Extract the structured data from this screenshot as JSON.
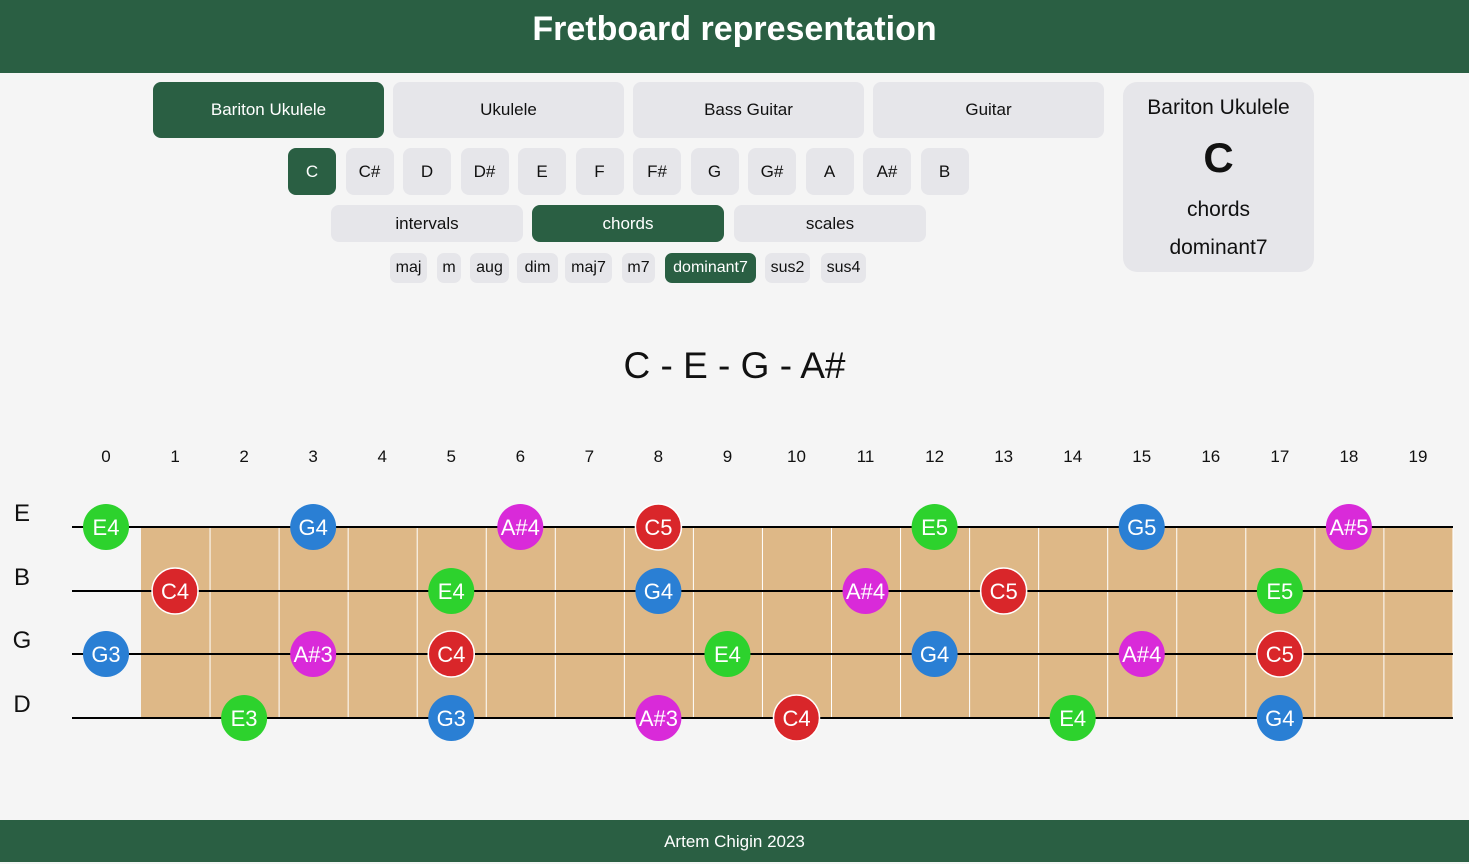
{
  "header": {
    "title": "Fretboard representation"
  },
  "instruments": [
    {
      "label": "Bariton Ukulele",
      "active": true
    },
    {
      "label": "Ukulele",
      "active": false
    },
    {
      "label": "Bass Guitar",
      "active": false
    },
    {
      "label": "Guitar",
      "active": false
    }
  ],
  "keys": [
    {
      "label": "C",
      "active": true
    },
    {
      "label": "C#",
      "active": false
    },
    {
      "label": "D",
      "active": false
    },
    {
      "label": "D#",
      "active": false
    },
    {
      "label": "E",
      "active": false
    },
    {
      "label": "F",
      "active": false
    },
    {
      "label": "F#",
      "active": false
    },
    {
      "label": "G",
      "active": false
    },
    {
      "label": "G#",
      "active": false
    },
    {
      "label": "A",
      "active": false
    },
    {
      "label": "A#",
      "active": false
    },
    {
      "label": "B",
      "active": false
    }
  ],
  "modes": [
    {
      "label": "intervals",
      "active": false
    },
    {
      "label": "chords",
      "active": true
    },
    {
      "label": "scales",
      "active": false
    }
  ],
  "chord_types": [
    {
      "label": "maj",
      "active": false
    },
    {
      "label": "m",
      "active": false
    },
    {
      "label": "aug",
      "active": false
    },
    {
      "label": "dim",
      "active": false
    },
    {
      "label": "maj7",
      "active": false
    },
    {
      "label": "m7",
      "active": false
    },
    {
      "label": "dominant7",
      "active": true
    },
    {
      "label": "sus2",
      "active": false
    },
    {
      "label": "sus4",
      "active": false
    }
  ],
  "info_card": {
    "instrument": "Bariton Ukulele",
    "key": "C",
    "mode": "chords",
    "type": "dominant7"
  },
  "notes_title": "C - E - G - A#",
  "fretboard": {
    "fret_numbers": [
      "0",
      "1",
      "2",
      "3",
      "4",
      "5",
      "6",
      "7",
      "8",
      "9",
      "10",
      "11",
      "12",
      "13",
      "14",
      "15",
      "16",
      "17",
      "18",
      "19"
    ],
    "note_colors": {
      "C": "#d9262a",
      "E": "#2dd22d",
      "G": "#2a7fd4",
      "A#": "#d92ad9"
    },
    "board_color": "#deb887",
    "strings": [
      {
        "name": "E",
        "markers": [
          {
            "fret": 0,
            "note": "E4"
          },
          {
            "fret": 3,
            "note": "G4"
          },
          {
            "fret": 6,
            "note": "A#4"
          },
          {
            "fret": 8,
            "note": "C5"
          },
          {
            "fret": 12,
            "note": "E5"
          },
          {
            "fret": 15,
            "note": "G5"
          },
          {
            "fret": 18,
            "note": "A#5"
          }
        ]
      },
      {
        "name": "B",
        "markers": [
          {
            "fret": 1,
            "note": "C4"
          },
          {
            "fret": 5,
            "note": "E4"
          },
          {
            "fret": 8,
            "note": "G4"
          },
          {
            "fret": 11,
            "note": "A#4"
          },
          {
            "fret": 13,
            "note": "C5"
          },
          {
            "fret": 17,
            "note": "E5"
          }
        ]
      },
      {
        "name": "G",
        "markers": [
          {
            "fret": 0,
            "note": "G3"
          },
          {
            "fret": 3,
            "note": "A#3"
          },
          {
            "fret": 5,
            "note": "C4"
          },
          {
            "fret": 9,
            "note": "E4"
          },
          {
            "fret": 12,
            "note": "G4"
          },
          {
            "fret": 15,
            "note": "A#4"
          },
          {
            "fret": 17,
            "note": "C5"
          }
        ]
      },
      {
        "name": "D",
        "markers": [
          {
            "fret": 2,
            "note": "E3"
          },
          {
            "fret": 5,
            "note": "G3"
          },
          {
            "fret": 8,
            "note": "A#3"
          },
          {
            "fret": 10,
            "note": "C4"
          },
          {
            "fret": 14,
            "note": "E4"
          },
          {
            "fret": 17,
            "note": "G4"
          }
        ]
      }
    ]
  },
  "footer": {
    "text": "Artem Chigin 2023"
  }
}
